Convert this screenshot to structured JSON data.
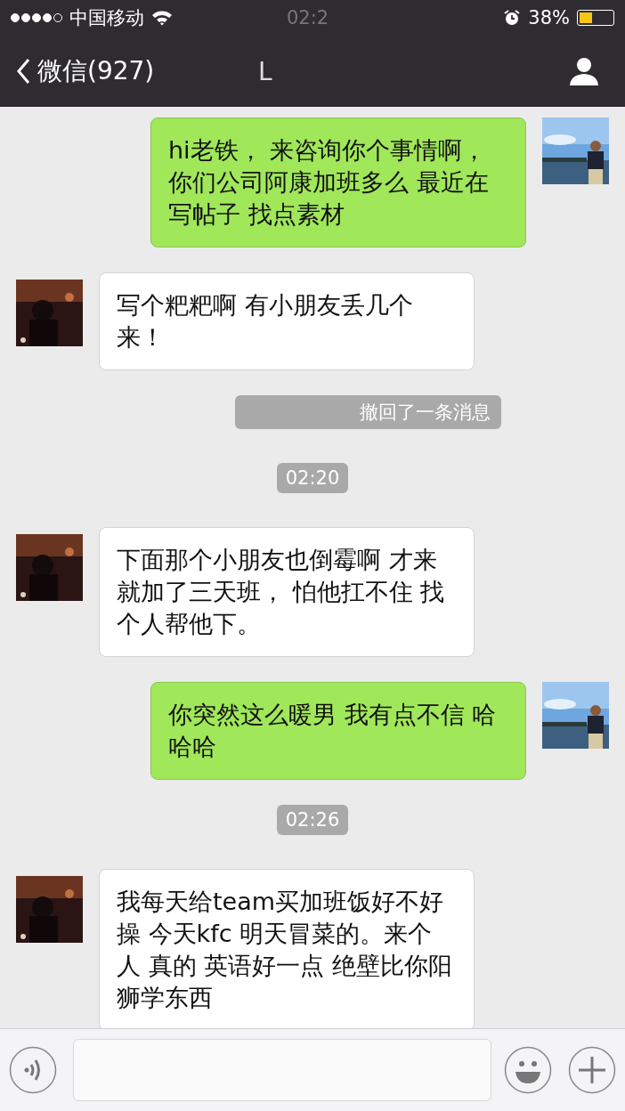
{
  "status_bar": {
    "signal_dots": [
      {
        "filled": true
      },
      {
        "filled": true
      },
      {
        "filled": true
      },
      {
        "filled": true
      },
      {
        "filled": false
      }
    ],
    "carrier": "中国移动",
    "time": "02:2",
    "battery": "38%"
  },
  "nav_bar": {
    "back_label": "微信(927)",
    "title": "L"
  },
  "messages": [
    {
      "kind": "sent",
      "text": "hi老铁， 来咨询你个事情啊，你们公司阿康加班多么 最近在写帖子 找点素材"
    },
    {
      "kind": "received",
      "text": "写个粑粑啊 有小朋友丢几个来！"
    },
    {
      "kind": "recall",
      "text": "撤回了一条消息"
    },
    {
      "kind": "time",
      "text": "02:20"
    },
    {
      "kind": "received",
      "text": "下面那个小朋友也倒霉啊 才来就加了三天班， 怕他扛不住 找个人帮他下。"
    },
    {
      "kind": "sent",
      "text": "你突然这么暖男 我有点不信 哈哈哈"
    },
    {
      "kind": "time",
      "text": "02:26"
    },
    {
      "kind": "received",
      "text": "我每天给team买加班饭好不好操 今天kfc 明天冒菜的。来个人 真的 英语好一点 绝壁比你阳狮学东西"
    }
  ]
}
